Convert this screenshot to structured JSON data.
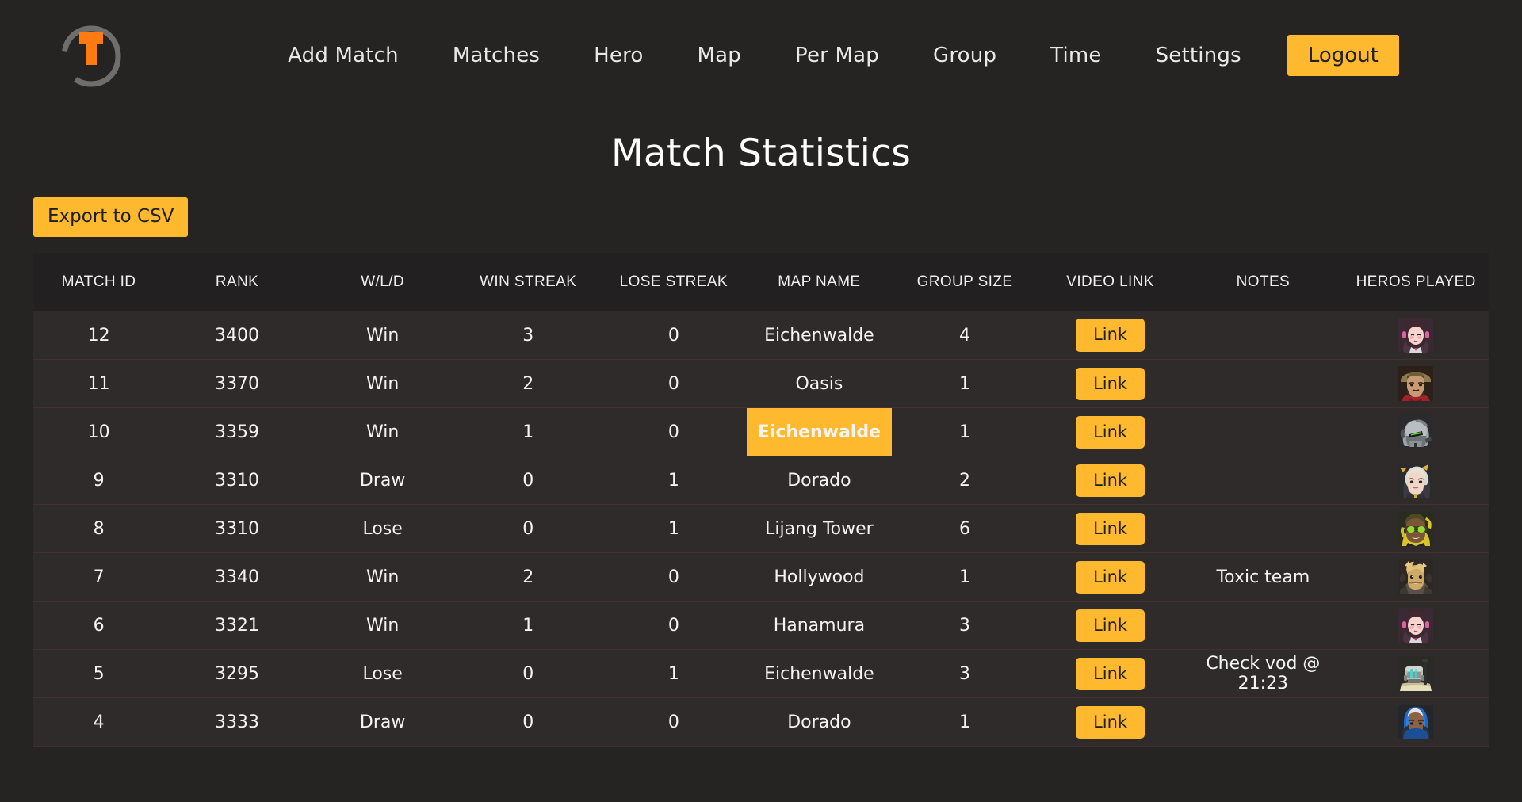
{
  "brand": {
    "logo_name": "tracer-ring-logo",
    "ring_color": "#6e6e6e",
    "mark_color": "#ff7a10"
  },
  "nav": {
    "items": [
      {
        "label": "Add Match",
        "name": "nav-add-match"
      },
      {
        "label": "Matches",
        "name": "nav-matches"
      },
      {
        "label": "Hero",
        "name": "nav-hero"
      },
      {
        "label": "Map",
        "name": "nav-map"
      },
      {
        "label": "Per Map",
        "name": "nav-per-map"
      },
      {
        "label": "Group",
        "name": "nav-group"
      },
      {
        "label": "Time",
        "name": "nav-time"
      },
      {
        "label": "Settings",
        "name": "nav-settings"
      }
    ],
    "logout_label": "Logout"
  },
  "page": {
    "title": "Match Statistics",
    "background": "#262423",
    "accent": "#ffb92e"
  },
  "toolbar": {
    "export_label": "Export to CSV"
  },
  "table": {
    "columns": [
      "MATCH ID",
      "RANK",
      "W/L/D",
      "WIN STREAK",
      "LOSE STREAK",
      "MAP NAME",
      "GROUP SIZE",
      "VIDEO LINK",
      "NOTES",
      "HEROS PLAYED"
    ],
    "link_label": "Link",
    "rows": [
      {
        "match_id": "12",
        "rank": "3400",
        "wld": "Win",
        "win_streak": "3",
        "lose_streak": "0",
        "map_name": "Eichenwalde",
        "map_highlight": false,
        "group_size": "4",
        "video": "Link",
        "notes": "",
        "hero": "dva",
        "hero_label": "D.Va"
      },
      {
        "match_id": "11",
        "rank": "3370",
        "wld": "Win",
        "win_streak": "2",
        "lose_streak": "0",
        "map_name": "Oasis",
        "map_highlight": false,
        "group_size": "1",
        "video": "Link",
        "notes": "",
        "hero": "mccree",
        "hero_label": "McCree"
      },
      {
        "match_id": "10",
        "rank": "3359",
        "wld": "Win",
        "win_streak": "1",
        "lose_streak": "0",
        "map_name": "Eichenwalde",
        "map_highlight": true,
        "group_size": "1",
        "video": "Link",
        "notes": "",
        "hero": "genji",
        "hero_label": "Genji"
      },
      {
        "match_id": "9",
        "rank": "3310",
        "wld": "Draw",
        "win_streak": "0",
        "lose_streak": "1",
        "map_name": "Dorado",
        "map_highlight": false,
        "group_size": "2",
        "video": "Link",
        "notes": "",
        "hero": "mercy",
        "hero_label": "Mercy"
      },
      {
        "match_id": "8",
        "rank": "3310",
        "wld": "Lose",
        "win_streak": "0",
        "lose_streak": "1",
        "map_name": "Lijang Tower",
        "map_highlight": false,
        "group_size": "6",
        "video": "Link",
        "notes": "",
        "hero": "lucio",
        "hero_label": "Lucio"
      },
      {
        "match_id": "7",
        "rank": "3340",
        "wld": "Win",
        "win_streak": "2",
        "lose_streak": "0",
        "map_name": "Hollywood",
        "map_highlight": false,
        "group_size": "1",
        "video": "Link",
        "notes": "Toxic team",
        "hero": "junkrat",
        "hero_label": "Junkrat"
      },
      {
        "match_id": "6",
        "rank": "3321",
        "wld": "Win",
        "win_streak": "1",
        "lose_streak": "0",
        "map_name": "Hanamura",
        "map_highlight": false,
        "group_size": "3",
        "video": "Link",
        "notes": "",
        "hero": "dva",
        "hero_label": "D.Va"
      },
      {
        "match_id": "5",
        "rank": "3295",
        "wld": "Lose",
        "win_streak": "0",
        "lose_streak": "1",
        "map_name": "Eichenwalde",
        "map_highlight": false,
        "group_size": "3",
        "video": "Link",
        "notes": "Check vod @ 21:23",
        "hero": "bastion",
        "hero_label": "Bastion"
      },
      {
        "match_id": "4",
        "rank": "3333",
        "wld": "Draw",
        "win_streak": "0",
        "lose_streak": "0",
        "map_name": "Dorado",
        "map_highlight": false,
        "group_size": "1",
        "video": "Link",
        "notes": "",
        "hero": "ana",
        "hero_label": "Ana"
      }
    ]
  }
}
